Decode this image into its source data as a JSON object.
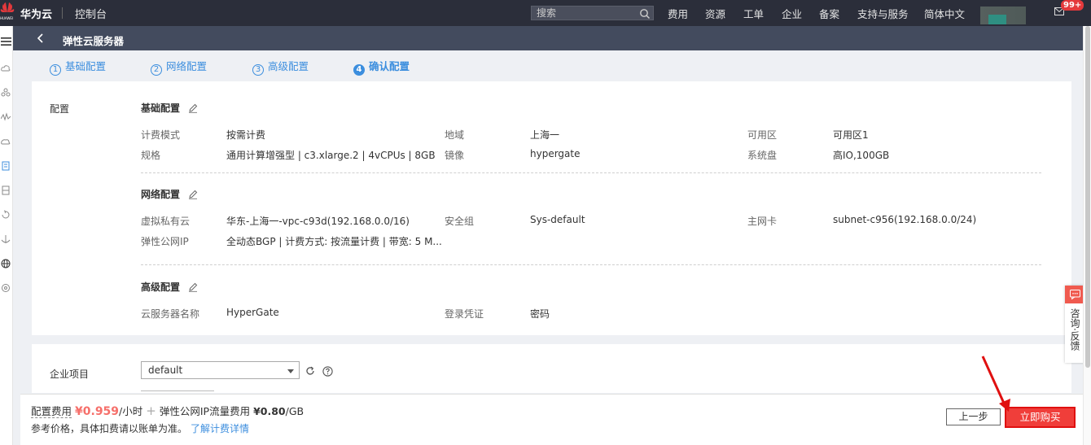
{
  "topbar": {
    "brand": "华为云",
    "brand_logo_text": "HUAWEI",
    "console": "控制台",
    "search_placeholder": "搜索",
    "nav": [
      "费用",
      "资源",
      "工单",
      "企业",
      "备案",
      "支持与服务",
      "简体中文"
    ],
    "badge": "99+"
  },
  "subheader": {
    "title": "弹性云服务器"
  },
  "steps": [
    {
      "num": "1",
      "label": "基础配置"
    },
    {
      "num": "2",
      "label": "网络配置"
    },
    {
      "num": "3",
      "label": "高级配置"
    },
    {
      "num": "4",
      "label": "确认配置"
    }
  ],
  "config": {
    "section_label": "配置",
    "basic": {
      "title": "基础配置",
      "billing_key": "计费模式",
      "billing_val": "按需计费",
      "region_key": "地域",
      "region_val": "上海一",
      "az_key": "可用区",
      "az_val": "可用区1",
      "spec_key": "规格",
      "spec_val": "通用计算增强型 | c3.xlarge.2 | 4vCPUs | 8GB",
      "image_key": "镜像",
      "image_val": "hypergate",
      "disk_key": "系统盘",
      "disk_val": "高IO,100GB"
    },
    "network": {
      "title": "网络配置",
      "vpc_key": "虚拟私有云",
      "vpc_val": "华东-上海一-vpc-c93d(192.168.0.0/16)",
      "sg_key": "安全组",
      "sg_val": "Sys-default",
      "nic_key": "主网卡",
      "nic_val": "subnet-c956(192.168.0.0/24)",
      "eip_key": "弹性公网IP",
      "eip_val": "全动态BGP | 计费方式: 按流量计费 | 带宽: 5 M..."
    },
    "advanced": {
      "title": "高级配置",
      "name_key": "云服务器名称",
      "name_val": "HyperGate",
      "cred_key": "登录凭证",
      "cred_val": "密码"
    }
  },
  "enterprise": {
    "label": "企业项目",
    "selected": "default"
  },
  "footer": {
    "fee_label": "配置费用",
    "price": "¥0.959",
    "price_unit": "/小时",
    "plus": "+",
    "eip_fee_label": "弹性公网IP流量费用",
    "eip_fee": "¥0.80",
    "eip_fee_unit": "/GB",
    "note": "参考价格，具体扣费请以账单为准。",
    "note_link": "了解计费详情",
    "prev_button": "上一步",
    "buy_button": "立即购买"
  },
  "feedback": {
    "label": "咨询·反馈"
  },
  "colors": {
    "accent": "#3c8ede",
    "price": "#f66f6a",
    "buy": "#f03e3a",
    "topbar": "#2b2e3a",
    "subheader": "#434b5e"
  }
}
